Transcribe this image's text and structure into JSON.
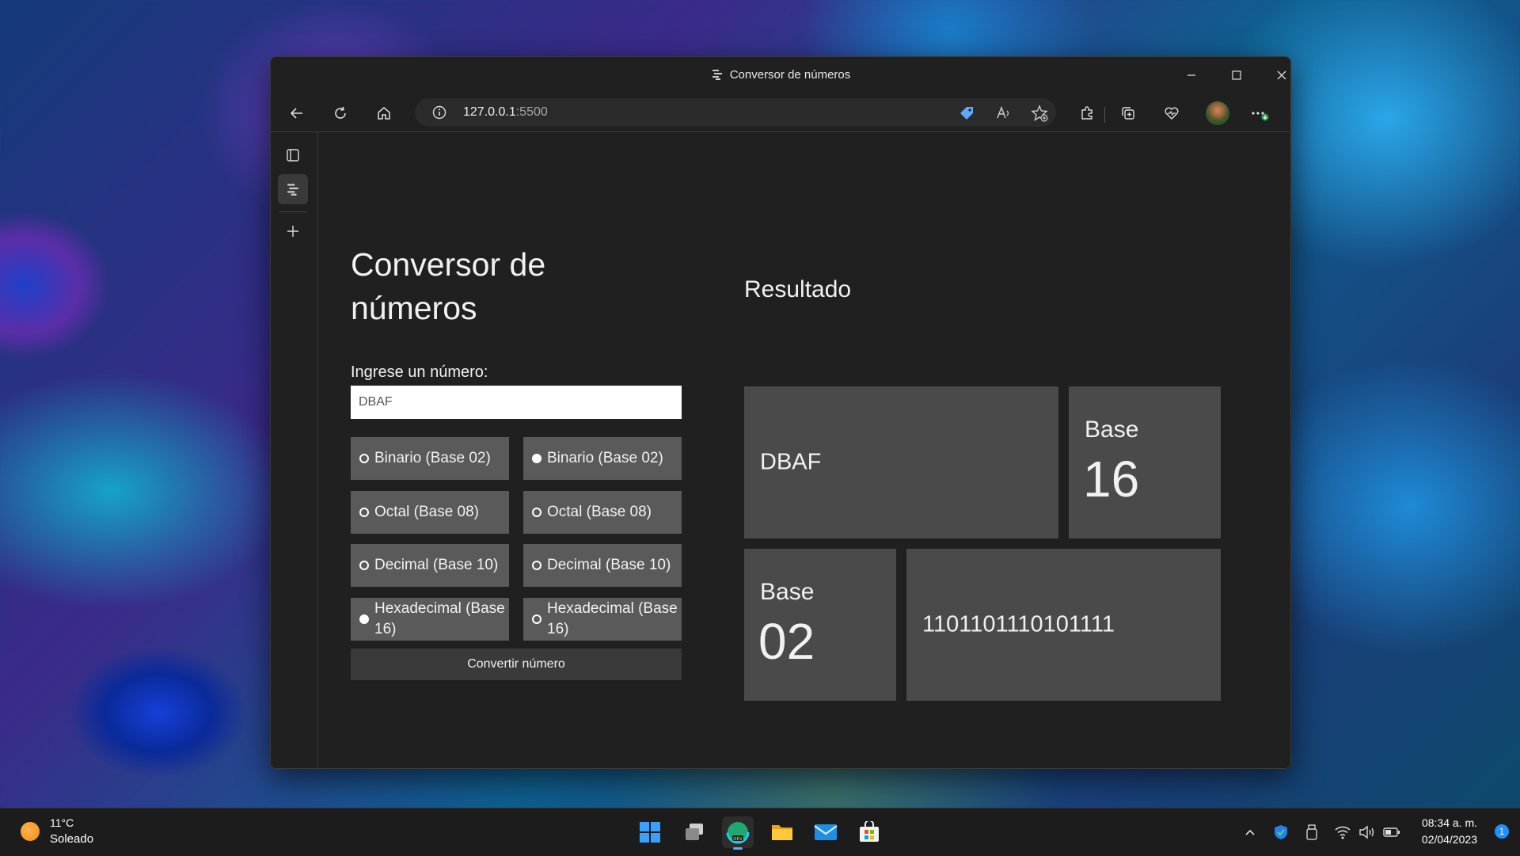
{
  "window": {
    "title": "Conversor de números"
  },
  "browser": {
    "url_host": "127.0.0.1",
    "url_port": ":5500"
  },
  "page": {
    "title": "Conversor de números",
    "input_label": "Ingrese un número:",
    "input_value": "DBAF",
    "from_options": [
      {
        "label": "Binario (Base 02)",
        "selected": false
      },
      {
        "label": "Octal (Base 08)",
        "selected": false
      },
      {
        "label": "Decimal (Base 10)",
        "selected": false
      },
      {
        "label": "Hexadecimal (Base 16)",
        "selected": true
      }
    ],
    "to_options": [
      {
        "label": "Binario (Base 02)",
        "selected": true
      },
      {
        "label": "Octal (Base 08)",
        "selected": false
      },
      {
        "label": "Decimal (Base 10)",
        "selected": false
      },
      {
        "label": "Hexadecimal (Base 16)",
        "selected": false
      }
    ],
    "convert_label": "Convertir número",
    "result": {
      "title": "Resultado",
      "input_value": "DBAF",
      "input_base_word": "Base",
      "input_base_num": "16",
      "output_base_word": "Base",
      "output_base_num": "02",
      "output_value": "1101101110101111"
    }
  },
  "taskbar": {
    "weather_temp": "11°C",
    "weather_desc": "Soleado",
    "time": "08:34 a. m.",
    "date": "02/04/2023",
    "notification_count": "1"
  },
  "colors": {
    "window_bg": "#202020",
    "option_bg": "#5a5a5a",
    "result_box_bg": "#4a4a4a",
    "button_bg": "#3a3a3a"
  }
}
